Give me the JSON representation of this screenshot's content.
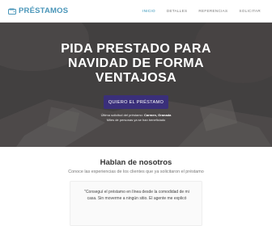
{
  "brand": {
    "name": "PRÉSTAMOS",
    "icon": "wallet-icon",
    "color": "#4a96b9"
  },
  "nav": {
    "items": [
      {
        "label": "INICIO",
        "active": true
      },
      {
        "label": "DETALLES",
        "active": false
      },
      {
        "label": "REFERENCIAS",
        "active": false
      },
      {
        "label": "SOLICITAR",
        "active": false
      }
    ]
  },
  "hero": {
    "title": "PIDA PRESTADO PARA NAVIDAD DE FORMA VENTAJOSA",
    "cta_label": "QUIERO EL PRÉSTAMO",
    "cta_color": "#3a2f7a",
    "note_prefix": "Última solicitud del préstamo:",
    "note_name": "Carmen, Granada",
    "note_line2": "Miles de personas ya se han beneficiado"
  },
  "testimonials": {
    "title": "Hablan de nosotros",
    "subtitle": "Conoce las experiencias de los clientes que ya solicitaron el préstamo",
    "quote": "\"Conseguí el préstamo en línea desde la comodidad de mi casa. Sin moverme a ningún sitio. El agente me explicó"
  }
}
